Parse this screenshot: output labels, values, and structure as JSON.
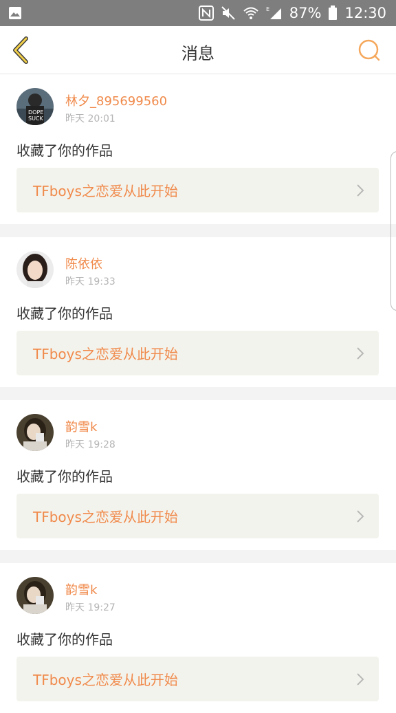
{
  "status_bar": {
    "battery": "87%",
    "time": "12:30",
    "icons": [
      "image-icon",
      "nfc-icon",
      "mute-icon",
      "wifi-icon",
      "signal-icon",
      "battery-icon"
    ]
  },
  "header": {
    "title": "消息",
    "back_icon": "chevron-left-icon",
    "search_icon": "search-icon",
    "accent_color": "#f5a85c"
  },
  "messages": [
    {
      "username": "林夕_895699560",
      "time": "昨天 20:01",
      "action": "收藏了你的作品",
      "work_title": "TFboys之恋爱从此开始"
    },
    {
      "username": "陈依依",
      "time": "昨天 19:33",
      "action": "收藏了你的作品",
      "work_title": "TFboys之恋爱从此开始"
    },
    {
      "username": "韵雪k",
      "time": "昨天 19:28",
      "action": "收藏了你的作品",
      "work_title": "TFboys之恋爱从此开始"
    },
    {
      "username": "韵雪k",
      "time": "昨天 19:27",
      "action": "收藏了你的作品",
      "work_title": "TFboys之恋爱从此开始"
    }
  ],
  "colors": {
    "username": "#f08a4b",
    "work_title": "#f08a4b",
    "link_bg": "#f3f3ed",
    "status_bar_bg": "#7e7e7e"
  }
}
